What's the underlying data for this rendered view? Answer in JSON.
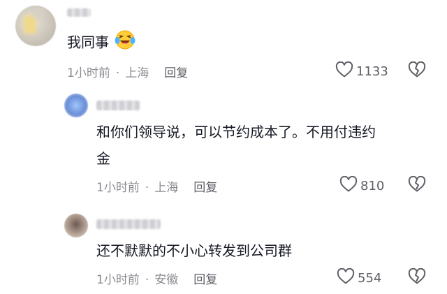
{
  "comments": [
    {
      "text": "我同事",
      "emoji": "laughing-crying-emoji",
      "time": "1小时前",
      "location": "上海",
      "reply_label": "回复",
      "likes": "1133"
    },
    {
      "text_line1": "和你们领导说，可以节约成本了。不用付违约",
      "text_line2": "金",
      "time": "1小时前",
      "location": "上海",
      "reply_label": "回复",
      "likes": "810"
    },
    {
      "text": "还不默默的不小心转发到公司群",
      "time": "1小时前",
      "location": "安徽",
      "reply_label": "回复",
      "likes": "554"
    }
  ],
  "separator": "·",
  "colors": {
    "text": "#161823",
    "meta": "#8a8b91",
    "action": "#5e5f66"
  },
  "icons": [
    "heart-icon",
    "broken-heart-icon"
  ]
}
